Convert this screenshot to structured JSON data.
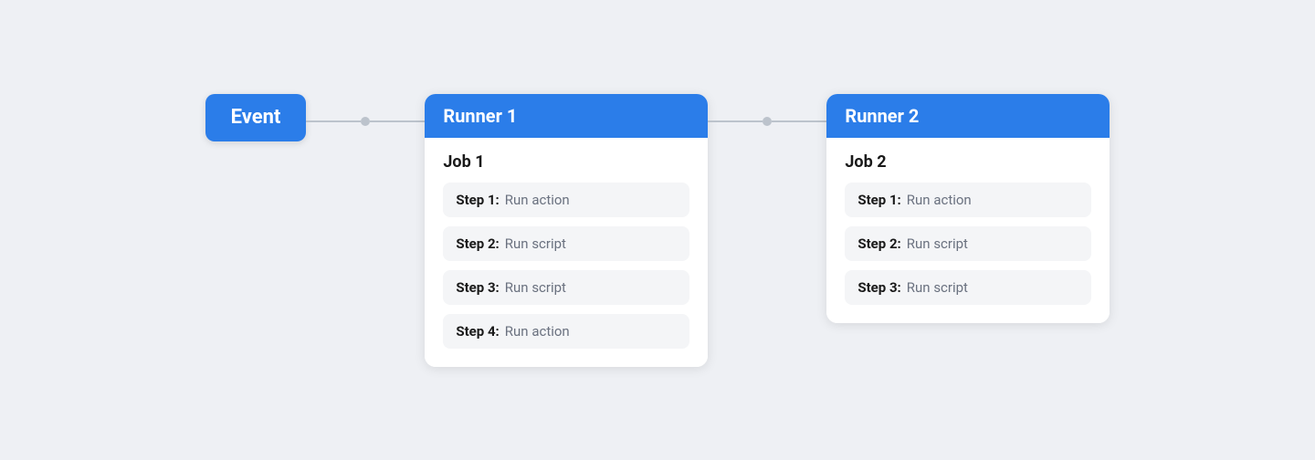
{
  "diagram": {
    "event": {
      "label": "Event"
    },
    "runners": [
      {
        "id": "runner1",
        "title": "Runner 1",
        "job": {
          "title": "Job 1",
          "steps": [
            {
              "label": "Step 1:",
              "value": "Run action"
            },
            {
              "label": "Step 2:",
              "value": "Run script"
            },
            {
              "label": "Step 3:",
              "value": "Run script"
            },
            {
              "label": "Step 4:",
              "value": "Run action"
            }
          ]
        }
      },
      {
        "id": "runner2",
        "title": "Runner 2",
        "job": {
          "title": "Job 2",
          "steps": [
            {
              "label": "Step 1:",
              "value": "Run action"
            },
            {
              "label": "Step 2:",
              "value": "Run script"
            },
            {
              "label": "Step 3:",
              "value": "Run script"
            }
          ]
        }
      }
    ],
    "colors": {
      "accent": "#2b7de9",
      "connector": "#bcc3cc",
      "background": "#eef0f4"
    }
  }
}
